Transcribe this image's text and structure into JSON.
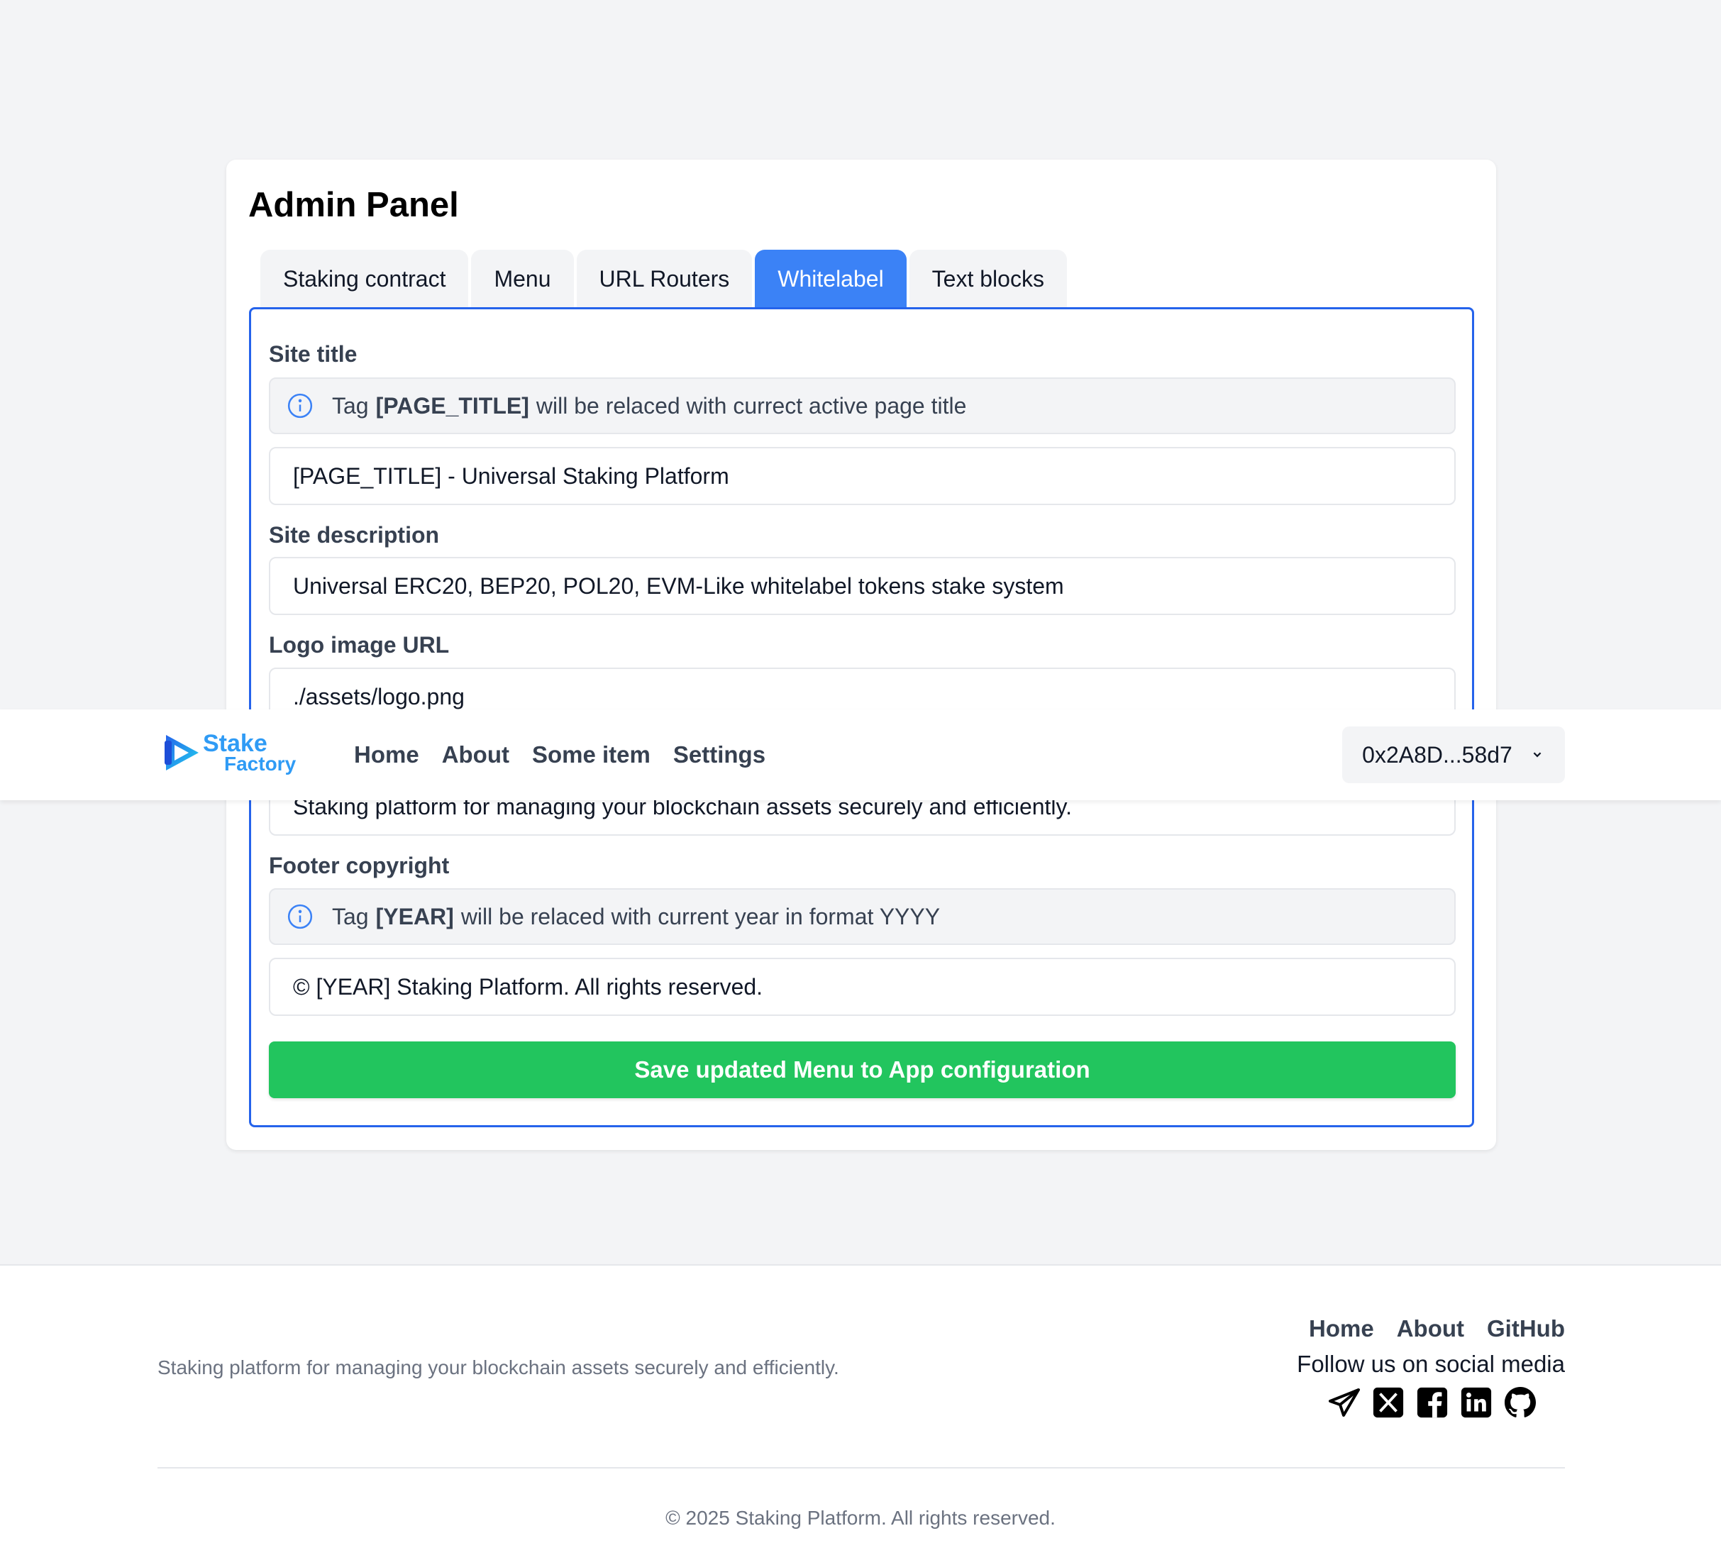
{
  "admin": {
    "title": "Admin Panel",
    "tabs": [
      {
        "label": "Staking contract"
      },
      {
        "label": "Menu"
      },
      {
        "label": "URL Routers"
      },
      {
        "label": "Whitelabel"
      },
      {
        "label": "Text blocks"
      }
    ],
    "active_tab": "Whitelabel",
    "fields": {
      "site_title": {
        "label": "Site title",
        "info_prefix": "Tag",
        "info_tag": "[PAGE_TITLE]",
        "info_suffix": "will be relaced with currect active page title",
        "value": "[PAGE_TITLE] - Universal Staking Platform"
      },
      "site_description": {
        "label": "Site description",
        "value": "Universal ERC20, BEP20, POL20, EVM-Like whitelabel tokens stake system"
      },
      "logo_url": {
        "label": "Logo image URL",
        "value": "./assets/logo.png"
      },
      "footer_description": {
        "value": "Staking platform for managing your blockchain assets securely and efficiently."
      },
      "footer_copyright": {
        "label": "Footer copyright",
        "info_prefix": "Tag",
        "info_tag": "[YEAR]",
        "info_suffix": "will be relaced with current year in format YYYY",
        "value": "© [YEAR] Staking Platform. All rights reserved."
      }
    },
    "save_label": "Save updated Menu to App configuration"
  },
  "navbar": {
    "logo_line1": "Stake",
    "logo_line2": "Factory",
    "links": [
      {
        "label": "Home"
      },
      {
        "label": "About"
      },
      {
        "label": "Some item"
      },
      {
        "label": "Settings"
      }
    ],
    "wallet": "0x2A8D...58d7"
  },
  "footer": {
    "description": "Staking platform for managing your blockchain assets securely and efficiently.",
    "links": [
      {
        "label": "Home"
      },
      {
        "label": "About"
      },
      {
        "label": "GitHub"
      }
    ],
    "follow": "Follow us on social media",
    "socials": [
      "telegram-icon",
      "x-icon",
      "facebook-icon",
      "linkedin-icon",
      "github-icon"
    ],
    "copyright": "© 2025 Staking Platform. All rights reserved."
  },
  "colors": {
    "accent": "#3b82f6",
    "panel_border": "#2563eb",
    "save_button": "#22c55e",
    "background": "#f3f4f6"
  }
}
